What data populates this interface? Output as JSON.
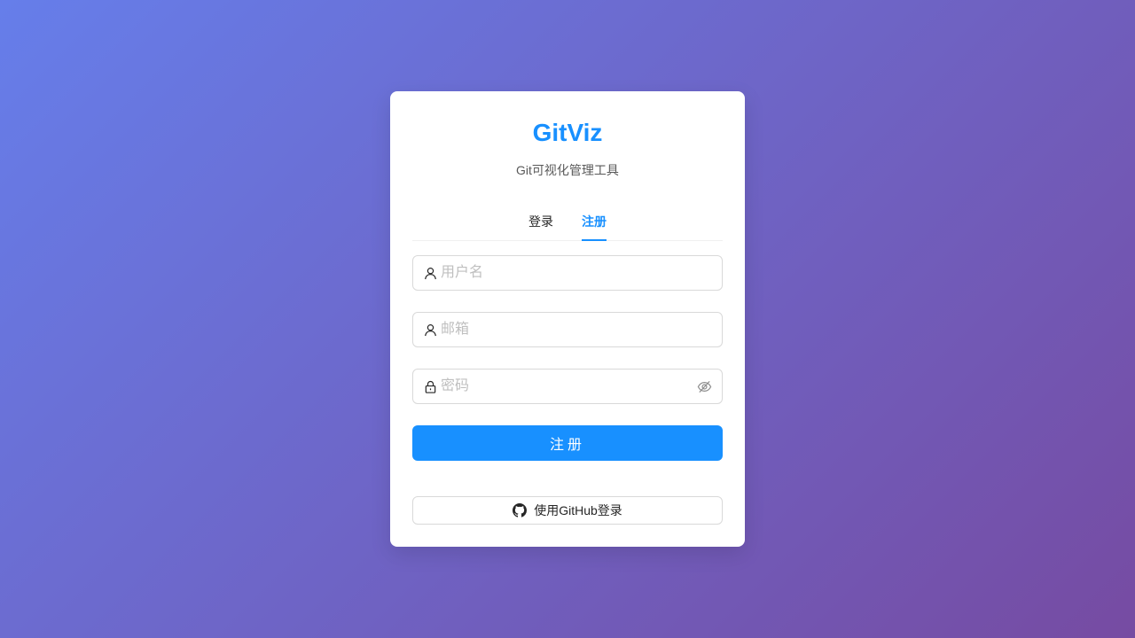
{
  "app": {
    "title": "GitViz",
    "subtitle": "Git可视化管理工具"
  },
  "tabs": [
    {
      "label": "登录",
      "active": false
    },
    {
      "label": "注册",
      "active": true
    }
  ],
  "form": {
    "username": {
      "placeholder": "用户名",
      "value": "",
      "icon": "user-icon"
    },
    "email": {
      "placeholder": "邮箱",
      "value": "",
      "icon": "user-icon"
    },
    "password": {
      "placeholder": "密码",
      "value": "",
      "icon": "lock-icon",
      "suffix_icon": "eye-invisible-icon"
    },
    "submit_label": "注册"
  },
  "github": {
    "label": "使用GitHub登录",
    "icon": "github-icon"
  },
  "colors": {
    "accent": "#1890ff",
    "background_start": "#667eea",
    "background_end": "#764ba2"
  }
}
